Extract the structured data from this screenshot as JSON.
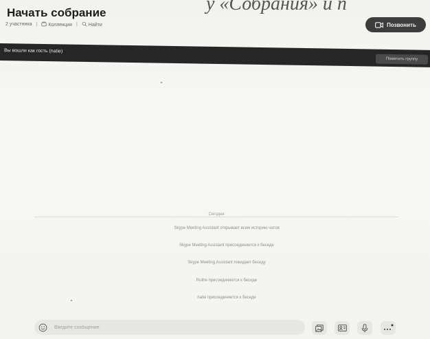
{
  "background_fragment": "у «Собрания» и п",
  "header": {
    "title": "Начать собрание",
    "participants": "2 участника",
    "collection": "Коллекция",
    "find": "Найти",
    "call_button": "Позвонить"
  },
  "banner": {
    "text": "Вы вошли как гость (natie)",
    "button": "Пометить группу"
  },
  "chat": {
    "date_separator": "Сегодня",
    "messages": [
      "Skype Meeting Assistant открывает всем историю чатов",
      "Skype Meeting Assistant присоединяется к беседе",
      "Skype Meeting Assistant покидает беседу",
      "Ruthe присоединяется к беседе",
      "natie присоединяется к беседе"
    ]
  },
  "composer": {
    "placeholder": "Введите сообщение"
  },
  "colors": {
    "banner_bg": "#262626",
    "call_button_bg": "#3d3d3d",
    "page_bg": "#f4f4f2"
  },
  "icons": {
    "emoji": "smiley-icon",
    "video": "video-camera-icon",
    "gallery": "image-gallery-icon",
    "contacts": "contact-card-icon",
    "mic": "microphone-icon",
    "more": "more-dots-icon",
    "collection": "collection-icon",
    "search": "search-icon"
  }
}
